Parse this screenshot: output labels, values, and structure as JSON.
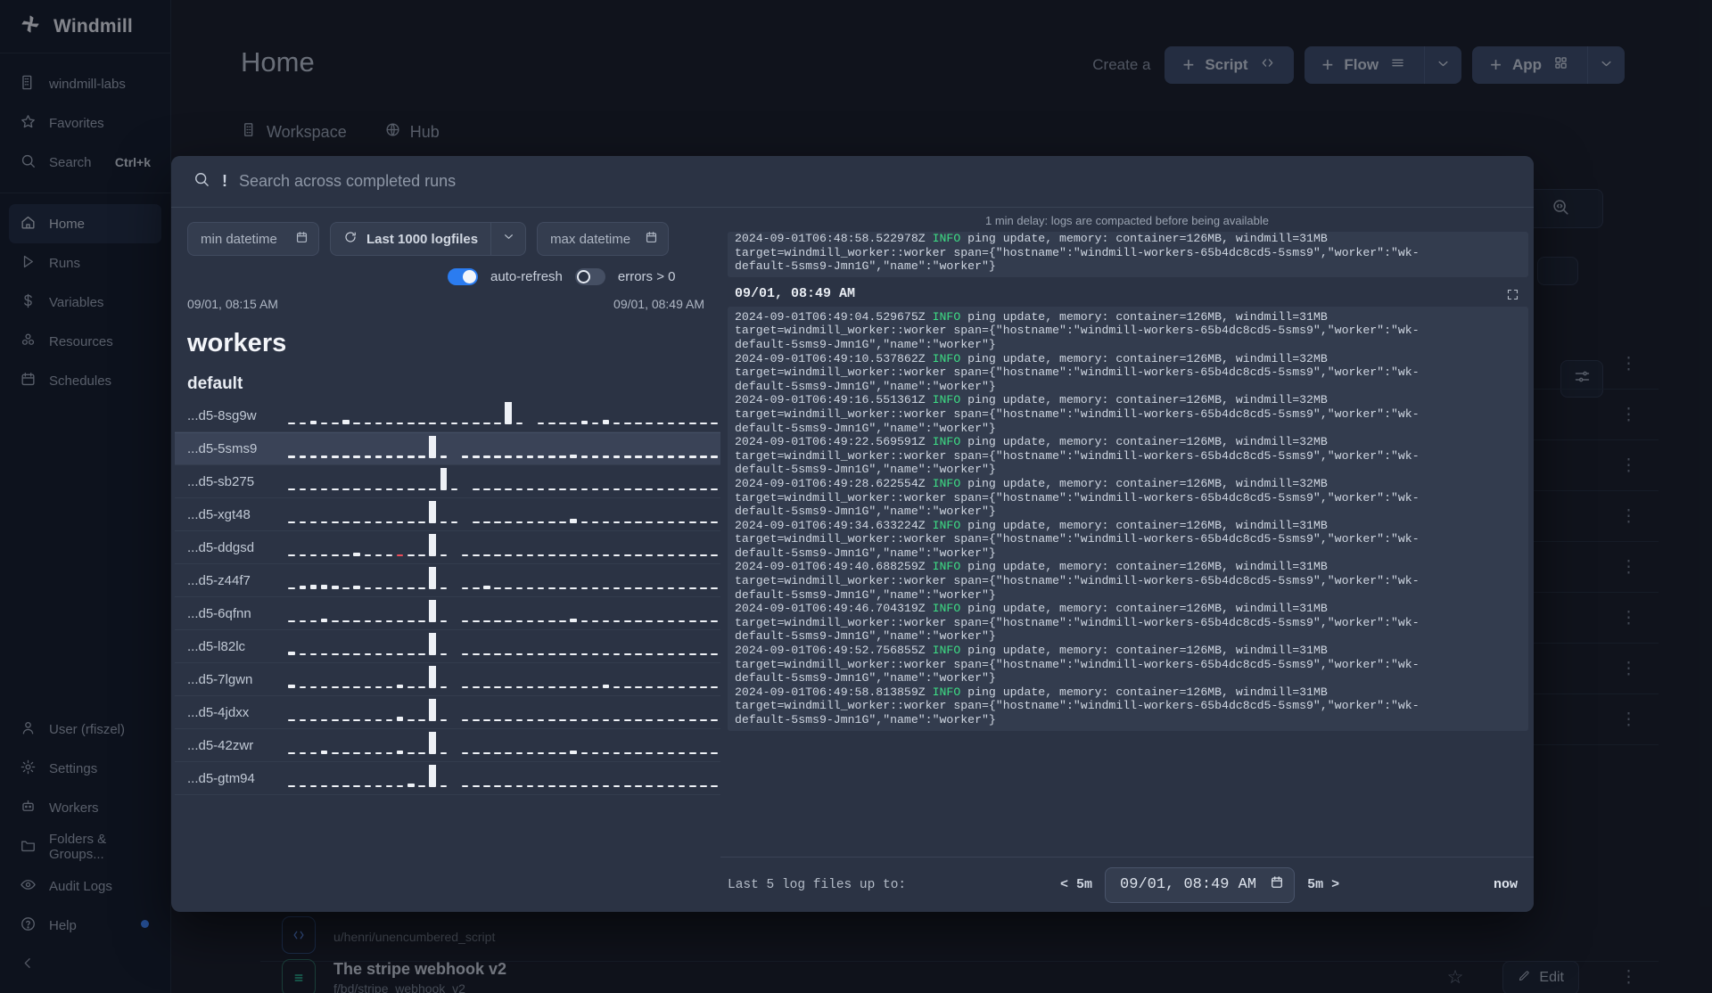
{
  "sidebar": {
    "brand": "Windmill",
    "top_items": [
      {
        "label": "windmill-labs",
        "icon": "building-icon"
      },
      {
        "label": "Favorites",
        "icon": "star-icon"
      },
      {
        "label": "Search",
        "icon": "search-icon",
        "shortcut": "Ctrl+k"
      }
    ],
    "nav_items": [
      {
        "label": "Home",
        "icon": "home-icon",
        "active": true
      },
      {
        "label": "Runs",
        "icon": "play-icon",
        "active": false
      },
      {
        "label": "Variables",
        "icon": "dollar-icon",
        "active": false
      },
      {
        "label": "Resources",
        "icon": "cubes-icon",
        "active": false
      },
      {
        "label": "Schedules",
        "icon": "calendar-icon",
        "active": false
      }
    ],
    "bottom_items": [
      {
        "label": "User (rfiszel)",
        "icon": "user-icon"
      },
      {
        "label": "Settings",
        "icon": "gear-icon"
      },
      {
        "label": "Workers",
        "icon": "robot-icon"
      },
      {
        "label": "Folders & Groups...",
        "icon": "folder-icon"
      },
      {
        "label": "Audit Logs",
        "icon": "eye-icon"
      },
      {
        "label": "Help",
        "icon": "help-icon"
      }
    ]
  },
  "header": {
    "title": "Home",
    "create_label": "Create a",
    "script_label": "Script",
    "flow_label": "Flow",
    "app_label": "App",
    "tabs": [
      {
        "label": "Workspace",
        "icon": "building-icon"
      },
      {
        "label": "Hub",
        "icon": "globe-icon"
      }
    ]
  },
  "background": {
    "items": [
      {
        "title": "",
        "path": "u/henri/unencumbered_script",
        "icon": "script-icon"
      },
      {
        "title": "The stripe webhook v2",
        "path": "f/bd/stripe_webhook_v2",
        "icon": "flow-icon",
        "edit_label": "Edit"
      }
    ]
  },
  "modal": {
    "search": {
      "placeholder": "Search across completed runs",
      "value": "",
      "bang": "!"
    },
    "filters": {
      "min_datetime_placeholder": "min datetime",
      "max_datetime_placeholder": "max datetime",
      "logfiles_label": "Last 1000 logfiles",
      "auto_refresh_label": "auto-refresh",
      "auto_refresh_on": true,
      "errors_label": "errors > 0",
      "errors_on": false,
      "range_start": "09/01, 08:15 AM",
      "range_end": "09/01, 08:49 AM"
    },
    "workers": {
      "heading": "workers",
      "queue": "default",
      "rows": [
        {
          "name": "...d5-8sg9w",
          "selected": false
        },
        {
          "name": "...d5-5sms9",
          "selected": true
        },
        {
          "name": "...d5-sb275",
          "selected": false
        },
        {
          "name": "...d5-xgt48",
          "selected": false
        },
        {
          "name": "...d5-ddgsd",
          "selected": false
        },
        {
          "name": "...d5-z44f7",
          "selected": false
        },
        {
          "name": "...d5-6qfnn",
          "selected": false
        },
        {
          "name": "...d5-l82lc",
          "selected": false
        },
        {
          "name": "...d5-7lgwn",
          "selected": false
        },
        {
          "name": "...d5-4jdxx",
          "selected": false
        },
        {
          "name": "...d5-42zwr",
          "selected": false
        },
        {
          "name": "...d5-gtm94",
          "selected": false
        }
      ]
    },
    "logs": {
      "delay_note": "1 min delay: logs are compacted before being available",
      "partial_tail": "default-5sms9-Jmn1G\",\"name\":\"worker\"}",
      "partial_text": "2024-09-01T06:48:58.522978Z |INFO| ping update, memory: container=126MB, windmill=31MB\ntarget=windmill_worker::worker span={\"hostname\":\"windmill-workers-65b4dc8cd5-5sms9\",\"worker\":\"wk-\ndefault-5sms9-Jmn1G\",\"name\":\"worker\"}",
      "chunk_header": "09/01, 08:49 AM",
      "chunk_text": "2024-09-01T06:49:04.529675Z |INFO| ping update, memory: container=126MB, windmill=31MB\ntarget=windmill_worker::worker span={\"hostname\":\"windmill-workers-65b4dc8cd5-5sms9\",\"worker\":\"wk-\ndefault-5sms9-Jmn1G\",\"name\":\"worker\"}\n2024-09-01T06:49:10.537862Z |INFO| ping update, memory: container=126MB, windmill=32MB\ntarget=windmill_worker::worker span={\"hostname\":\"windmill-workers-65b4dc8cd5-5sms9\",\"worker\":\"wk-\ndefault-5sms9-Jmn1G\",\"name\":\"worker\"}\n2024-09-01T06:49:16.551361Z |INFO| ping update, memory: container=126MB, windmill=32MB\ntarget=windmill_worker::worker span={\"hostname\":\"windmill-workers-65b4dc8cd5-5sms9\",\"worker\":\"wk-\ndefault-5sms9-Jmn1G\",\"name\":\"worker\"}\n2024-09-01T06:49:22.569591Z |INFO| ping update, memory: container=126MB, windmill=32MB\ntarget=windmill_worker::worker span={\"hostname\":\"windmill-workers-65b4dc8cd5-5sms9\",\"worker\":\"wk-\ndefault-5sms9-Jmn1G\",\"name\":\"worker\"}\n2024-09-01T06:49:28.622554Z |INFO| ping update, memory: container=126MB, windmill=32MB\ntarget=windmill_worker::worker span={\"hostname\":\"windmill-workers-65b4dc8cd5-5sms9\",\"worker\":\"wk-\ndefault-5sms9-Jmn1G\",\"name\":\"worker\"}\n2024-09-01T06:49:34.633224Z |INFO| ping update, memory: container=126MB, windmill=31MB\ntarget=windmill_worker::worker span={\"hostname\":\"windmill-workers-65b4dc8cd5-5sms9\",\"worker\":\"wk-\ndefault-5sms9-Jmn1G\",\"name\":\"worker\"}\n2024-09-01T06:49:40.688259Z |INFO| ping update, memory: container=126MB, windmill=31MB\ntarget=windmill_worker::worker span={\"hostname\":\"windmill-workers-65b4dc8cd5-5sms9\",\"worker\":\"wk-\ndefault-5sms9-Jmn1G\",\"name\":\"worker\"}\n2024-09-01T06:49:46.704319Z |INFO| ping update, memory: container=126MB, windmill=31MB\ntarget=windmill_worker::worker span={\"hostname\":\"windmill-workers-65b4dc8cd5-5sms9\",\"worker\":\"wk-\ndefault-5sms9-Jmn1G\",\"name\":\"worker\"}\n2024-09-01T06:49:52.756855Z |INFO| ping update, memory: container=126MB, windmill=31MB\ntarget=windmill_worker::worker span={\"hostname\":\"windmill-workers-65b4dc8cd5-5sms9\",\"worker\":\"wk-\ndefault-5sms9-Jmn1G\",\"name\":\"worker\"}\n2024-09-01T06:49:58.813859Z |INFO| ping update, memory: container=126MB, windmill=31MB\ntarget=windmill_worker::worker span={\"hostname\":\"windmill-workers-65b4dc8cd5-5sms9\",\"worker\":\"wk-\ndefault-5sms9-Jmn1G\",\"name\":\"worker\"}",
      "footer_label": "Last 5 log files up to:",
      "prev_label": "< 5m",
      "next_label": "5m >",
      "datetime_value": "09/01, 08:49 AM",
      "now_label": "now"
    }
  },
  "colors": {
    "accent": "#2b7cf0",
    "sidebar_bg": "#111827",
    "modal_bg": "#2b3344",
    "log_bg": "#333c4e",
    "info_green": "#3ddc84",
    "error_red": "#ef4d5a",
    "bar": "#eef1f6"
  },
  "chart_data": {
    "type": "bar",
    "title": "workers",
    "xlabel": "",
    "ylabel": "",
    "note": "per-worker sparkline of job counts over the selected window; tall bar = spike",
    "series": [
      {
        "name": "...d5-8sg9w",
        "values": [
          1,
          1,
          3,
          1,
          1,
          4,
          1,
          1,
          1,
          1,
          1,
          1,
          1,
          1,
          1,
          1,
          1,
          1,
          1,
          1,
          22,
          2,
          0,
          1,
          1,
          1,
          1,
          3,
          2,
          4,
          1,
          1,
          1,
          1,
          1,
          1,
          1,
          1,
          1,
          1
        ]
      },
      {
        "name": "...d5-5sms9",
        "values": [
          1,
          1,
          1,
          1,
          2,
          1,
          1,
          1,
          1,
          2,
          1,
          1,
          2,
          22,
          1,
          0,
          1,
          1,
          2,
          1,
          1,
          1,
          1,
          1,
          2,
          1,
          3,
          1,
          2,
          1,
          1,
          2,
          1,
          1,
          1,
          1,
          1,
          1,
          1,
          1
        ]
      },
      {
        "name": "...d5-sb275",
        "values": [
          1,
          2,
          1,
          1,
          1,
          1,
          1,
          1,
          2,
          1,
          1,
          2,
          1,
          1,
          22,
          1,
          0,
          2,
          1,
          1,
          1,
          1,
          1,
          1,
          2,
          1,
          1,
          1,
          1,
          1,
          1,
          1,
          2,
          1,
          1,
          1,
          1,
          1,
          1,
          1
        ]
      },
      {
        "name": "...d5-xgt48",
        "values": [
          1,
          1,
          1,
          1,
          1,
          1,
          1,
          1,
          1,
          1,
          1,
          1,
          1,
          22,
          1,
          1,
          0,
          1,
          1,
          1,
          1,
          2,
          1,
          1,
          1,
          1,
          4,
          1,
          1,
          1,
          1,
          1,
          1,
          1,
          1,
          1,
          1,
          1,
          1,
          1
        ]
      },
      {
        "name": "...d5-ddgsd",
        "values": [
          1,
          1,
          2,
          1,
          1,
          1,
          3,
          1,
          1,
          1,
          2,
          1,
          1,
          22,
          1,
          0,
          1,
          1,
          1,
          1,
          1,
          2,
          1,
          1,
          1,
          1,
          1,
          1,
          1,
          1,
          1,
          1,
          1,
          1,
          1,
          1,
          1,
          1,
          1,
          1
        ]
      },
      {
        "name": "...d5-z44f7",
        "values": [
          1,
          3,
          4,
          4,
          3,
          2,
          3,
          1,
          1,
          1,
          1,
          1,
          1,
          22,
          1,
          0,
          1,
          1,
          3,
          1,
          1,
          1,
          1,
          1,
          2,
          1,
          1,
          1,
          1,
          1,
          1,
          1,
          1,
          1,
          1,
          1,
          1,
          1,
          1,
          1
        ]
      },
      {
        "name": "...d5-6qfnn",
        "values": [
          1,
          1,
          1,
          3,
          1,
          1,
          1,
          1,
          1,
          1,
          1,
          1,
          1,
          22,
          1,
          0,
          1,
          1,
          1,
          1,
          1,
          1,
          1,
          1,
          2,
          1,
          3,
          1,
          1,
          1,
          1,
          1,
          1,
          1,
          1,
          1,
          1,
          1,
          1,
          1
        ]
      },
      {
        "name": "...d5-l82lc",
        "values": [
          3,
          2,
          1,
          1,
          1,
          1,
          1,
          1,
          1,
          1,
          1,
          1,
          2,
          22,
          1,
          0,
          1,
          1,
          1,
          1,
          1,
          1,
          1,
          1,
          1,
          1,
          1,
          1,
          2,
          1,
          1,
          1,
          1,
          1,
          1,
          1,
          1,
          1,
          1,
          1
        ]
      },
      {
        "name": "...d5-7lgwn",
        "values": [
          3,
          1,
          1,
          1,
          1,
          1,
          1,
          2,
          1,
          1,
          3,
          1,
          2,
          22,
          1,
          0,
          1,
          1,
          1,
          1,
          1,
          2,
          1,
          1,
          1,
          1,
          1,
          1,
          1,
          3,
          1,
          1,
          1,
          1,
          1,
          1,
          1,
          1,
          1,
          1
        ]
      },
      {
        "name": "...d5-4jdxx",
        "values": [
          1,
          1,
          1,
          1,
          1,
          2,
          1,
          1,
          1,
          1,
          4,
          1,
          1,
          22,
          1,
          0,
          1,
          1,
          1,
          1,
          1,
          1,
          1,
          1,
          1,
          1,
          1,
          1,
          1,
          1,
          1,
          1,
          1,
          1,
          1,
          1,
          1,
          1,
          1,
          1
        ]
      },
      {
        "name": "...d5-42zwr",
        "values": [
          1,
          1,
          2,
          3,
          1,
          1,
          1,
          1,
          1,
          1,
          3,
          1,
          1,
          22,
          1,
          0,
          1,
          1,
          1,
          1,
          1,
          2,
          1,
          1,
          1,
          1,
          3,
          1,
          1,
          1,
          1,
          1,
          1,
          1,
          1,
          1,
          1,
          1,
          1,
          1
        ]
      },
      {
        "name": "...d5-gtm94",
        "values": [
          1,
          1,
          1,
          1,
          1,
          1,
          1,
          1,
          1,
          2,
          1,
          3,
          1,
          22,
          1,
          0,
          1,
          1,
          1,
          1,
          1,
          1,
          1,
          1,
          1,
          2,
          1,
          1,
          1,
          1,
          1,
          1,
          1,
          1,
          1,
          1,
          1,
          1,
          1,
          1
        ]
      }
    ],
    "errors": [
      {
        "series": "...d5-ddgsd",
        "index": 10
      }
    ]
  }
}
